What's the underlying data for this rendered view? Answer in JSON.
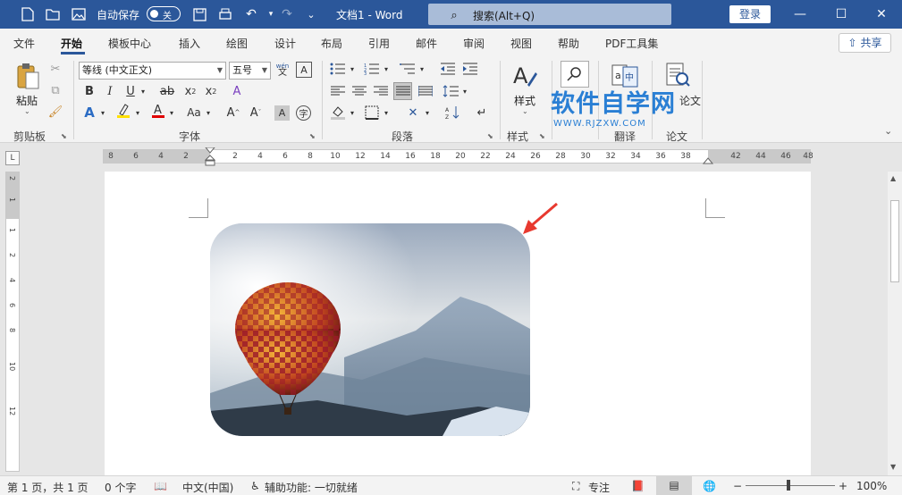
{
  "titlebar": {
    "autosave_label": "自动保存",
    "autosave_state": "关",
    "doc_title": "文档1  -  Word",
    "search_placeholder": "搜索(Alt+Q)",
    "login_label": "登录"
  },
  "tabs": [
    "文件",
    "开始",
    "模板中心",
    "插入",
    "绘图",
    "设计",
    "布局",
    "引用",
    "邮件",
    "审阅",
    "视图",
    "帮助",
    "PDF工具集"
  ],
  "active_tab": "开始",
  "share_label": "共享",
  "ribbon": {
    "clipboard": {
      "paste_label": "粘贴",
      "group_label": "剪贴板"
    },
    "font": {
      "font_name": "等线 (中文正文)",
      "font_size": "五号",
      "phonetic": "wén",
      "group_label": "字体"
    },
    "paragraph": {
      "group_label": "段落"
    },
    "styles": {
      "styles_label": "样式",
      "group_label": "样式"
    },
    "translate": {
      "group_label": "翻译"
    },
    "paper": {
      "paper_label": "论文",
      "group_label": "论文"
    }
  },
  "watermark": {
    "title": "软件自学网",
    "url": "WWW.RJZXW.COM"
  },
  "ruler": {
    "corner": "L",
    "left_numbers": [
      "8",
      "6",
      "4",
      "2"
    ],
    "numbers": [
      "2",
      "4",
      "6",
      "8",
      "10",
      "12",
      "14",
      "16",
      "18",
      "20",
      "22",
      "24",
      "26",
      "28",
      "30",
      "32",
      "34",
      "36",
      "38"
    ],
    "right_numbers": [
      "42",
      "44",
      "46",
      "48"
    ],
    "vertical": [
      "2",
      "1",
      "1",
      "2",
      "4",
      "6",
      "8",
      "10",
      "12"
    ]
  },
  "statusbar": {
    "page": "第 1 页，共 1 页",
    "words": "0 个字",
    "language": "中文(中国)",
    "accessibility": "辅助功能: 一切就绪",
    "focus": "专注",
    "zoom": "100%"
  },
  "colors": {
    "titlebar": "#2b579a",
    "highlight": "#ffe000",
    "font_color": "#e00000",
    "watermark": "#2a7fd4",
    "arrow": "#e8392f"
  }
}
